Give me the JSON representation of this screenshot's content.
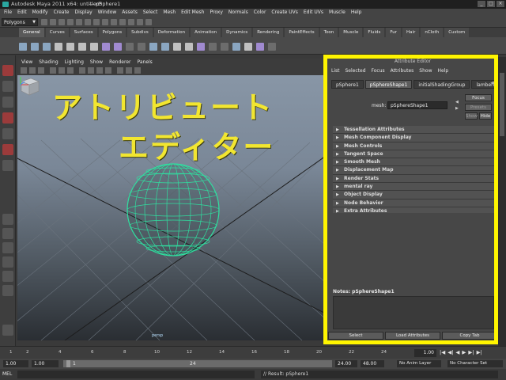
{
  "window": {
    "title": "Autodesk Maya 2011 x64: untitled*",
    "separator": "---",
    "document": "pSphere1",
    "buttons": [
      "_",
      "□",
      "×"
    ]
  },
  "menubar": [
    "File",
    "Edit",
    "Modify",
    "Create",
    "Display",
    "Window",
    "Assets",
    "Select",
    "Mesh",
    "Edit Mesh",
    "Proxy",
    "Normals",
    "Color",
    "Create UVs",
    "Edit UVs",
    "Muscle",
    "Help"
  ],
  "status": {
    "mode": "Polygons"
  },
  "shelf": {
    "tabs": [
      "General",
      "Curves",
      "Surfaces",
      "Polygons",
      "Subdivs",
      "Deformation",
      "Animation",
      "Dynamics",
      "Rendering",
      "PaintEffects",
      "Toon",
      "Muscle",
      "Fluids",
      "Fur",
      "Hair",
      "nCloth",
      "Custom"
    ],
    "active_tab": "General"
  },
  "viewport": {
    "menu": [
      "View",
      "Shading",
      "Lighting",
      "Show",
      "Renderer",
      "Panels"
    ],
    "overlay_line1": "アトリビュート",
    "overlay_line2": "エディター",
    "camera_label": "persp"
  },
  "attribute_editor": {
    "header": "Attribute Editor",
    "menu": [
      "List",
      "Selected",
      "Focus",
      "Attributes",
      "Show",
      "Help"
    ],
    "tabs": [
      "pSphere1",
      "pSphereShape1",
      "initialShadingGroup",
      "lambert1"
    ],
    "active_tab": "pSphereShape1",
    "mesh_label": "mesh:",
    "mesh_value": "pSphereShape1",
    "focus_label": "Focus",
    "presets_label": "Presets",
    "show_label": "Show",
    "hide_label": "Hide",
    "sections": [
      "Tessellation Attributes",
      "Mesh Component Display",
      "Mesh Controls",
      "Tangent Space",
      "Smooth Mesh",
      "Displacement Map",
      "Render Stats",
      "mental ray",
      "Object Display",
      "Node Behavior",
      "Extra Attributes"
    ],
    "notes_label": "Notes:",
    "notes_node": "pSphereShape1",
    "buttons": [
      "Select",
      "Load Attributes",
      "Copy Tab"
    ]
  },
  "highlight_color": "#fff500",
  "timeline": {
    "tick_labels": [
      "1",
      "2",
      "4",
      "6",
      "8",
      "10",
      "12",
      "14",
      "16",
      "18",
      "20",
      "22",
      "24"
    ],
    "current_frame": "1.00",
    "play_controls": [
      "|◀",
      "◀|",
      "◀",
      "▶",
      "▶|",
      "▶|"
    ]
  },
  "range": {
    "start": "1.00",
    "start2": "1.00",
    "range_start": "1",
    "range_end": "24",
    "end": "24.00",
    "end2": "48.00",
    "anim_layer": "No Anim Layer",
    "char_set": "No Character Set"
  },
  "command": {
    "label": "MEL",
    "result": "// Result: pSphere1"
  }
}
